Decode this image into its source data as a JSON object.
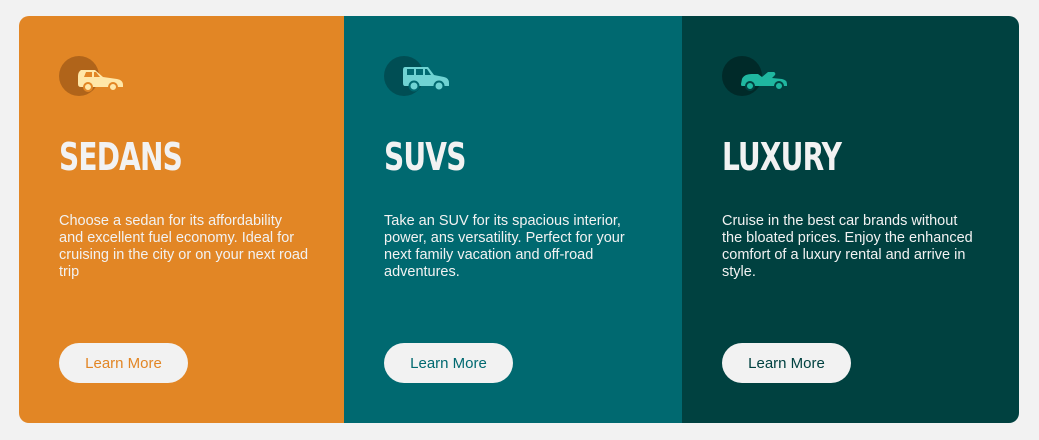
{
  "colors": {
    "page_background": "#f2f2f2",
    "sedans": "#e28625",
    "suvs": "#006970",
    "luxury": "#004140",
    "text_light": "#f2f2f2"
  },
  "cards": [
    {
      "icon": "sedan-car-icon",
      "title": "SEDANS",
      "description": "Choose a sedan for its affordability and excellent fuel economy. Ideal for cruising in the city or on your next road trip",
      "button_label": "Learn More"
    },
    {
      "icon": "suv-car-icon",
      "title": "SUVS",
      "description": "Take an SUV for its spacious interior, power, ans versatility. Perfect for your next family vacation and off-road adventures.",
      "button_label": "Learn More"
    },
    {
      "icon": "luxury-car-icon",
      "title": "LUXURY",
      "description": "Cruise in the best car brands without the bloated prices. Enjoy the enhanced comfort of a luxury rental and arrive in style.",
      "button_label": "Learn More"
    }
  ]
}
